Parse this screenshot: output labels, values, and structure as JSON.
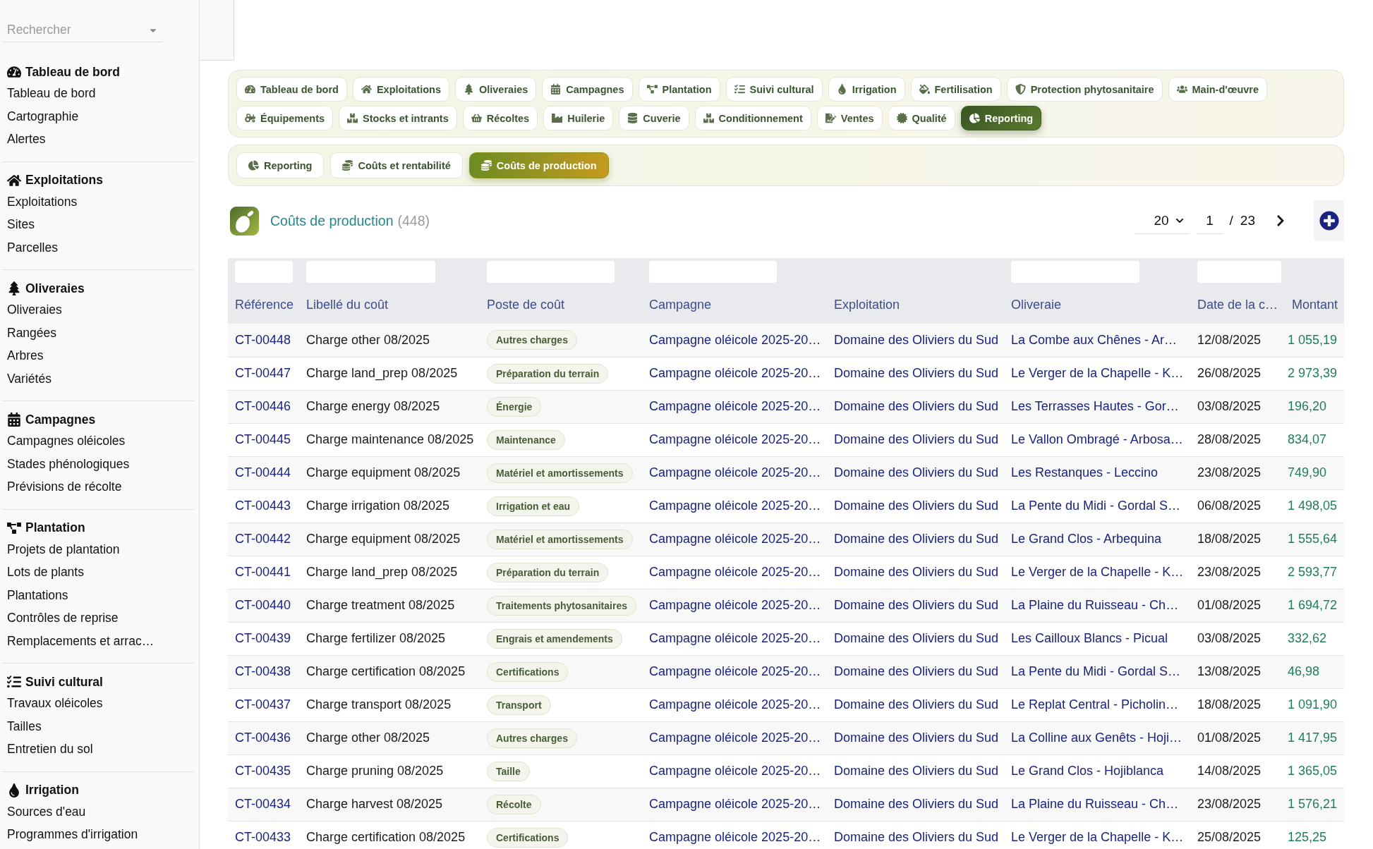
{
  "sidebar": {
    "search": {
      "placeholder": "Rechercher"
    },
    "groups": [
      {
        "title": "Tableau de bord",
        "items": [
          "Tableau de bord",
          "Cartographie",
          "Alertes"
        ]
      },
      {
        "title": "Exploitations",
        "items": [
          "Exploitations",
          "Sites",
          "Parcelles"
        ]
      },
      {
        "title": "Oliveraies",
        "items": [
          "Oliveraies",
          "Rangées",
          "Arbres",
          "Variétés"
        ]
      },
      {
        "title": "Campagnes",
        "items": [
          "Campagnes oléicoles",
          "Stades phénologiques",
          "Prévisions de récolte"
        ]
      },
      {
        "title": "Plantation",
        "items": [
          "Projets de plantation",
          "Lots de plants",
          "Plantations",
          "Contrôles de reprise",
          "Remplacements et arrac…"
        ]
      },
      {
        "title": "Suivi cultural",
        "items": [
          "Travaux oléicoles",
          "Tailles",
          "Entretien du sol"
        ]
      },
      {
        "title": "Irrigation",
        "items": [
          "Sources d'eau",
          "Programmes d'irrigation"
        ]
      }
    ]
  },
  "module_nav": [
    [
      {
        "label": "Tableau de bord",
        "selected": false
      },
      {
        "label": "Exploitations",
        "selected": false
      },
      {
        "label": "Oliveraies",
        "selected": false
      },
      {
        "label": "Campagnes",
        "selected": false
      },
      {
        "label": "Plantation",
        "selected": false
      },
      {
        "label": "Suivi cultural",
        "selected": false
      },
      {
        "label": "Irrigation",
        "selected": false
      },
      {
        "label": "Fertilisation",
        "selected": false
      },
      {
        "label": "Protection phytosanitaire",
        "selected": false
      },
      {
        "label": "Main-d'œuvre",
        "selected": false
      }
    ],
    [
      {
        "label": "Équipements",
        "selected": false
      },
      {
        "label": "Stocks et intrants",
        "selected": false
      },
      {
        "label": "Récoltes",
        "selected": false
      },
      {
        "label": "Huilerie",
        "selected": false
      },
      {
        "label": "Cuverie",
        "selected": false
      },
      {
        "label": "Conditionnement",
        "selected": false
      },
      {
        "label": "Ventes",
        "selected": false
      },
      {
        "label": "Qualité",
        "selected": false
      },
      {
        "label": "Reporting",
        "selected": true
      }
    ]
  ],
  "sub_nav": [
    {
      "label": "Reporting",
      "selected": false
    },
    {
      "label": "Coûts et rentabilité",
      "selected": false
    },
    {
      "label": "Coûts de production",
      "selected": true
    }
  ],
  "list_header": {
    "title": "Coûts de production",
    "count": "(448)",
    "page_size": "20",
    "page": "1",
    "separator": "/",
    "page_count": "23"
  },
  "table": {
    "columns": [
      {
        "label": "Référence",
        "filter": true
      },
      {
        "label": "Libellé du coût",
        "filter": true
      },
      {
        "label": "Poste de coût",
        "filter": true
      },
      {
        "label": "Campagne",
        "filter": true
      },
      {
        "label": "Exploitation",
        "filter": false
      },
      {
        "label": "Oliveraie",
        "filter": true
      },
      {
        "label": "Date de la c…",
        "filter": true
      },
      {
        "label": "Montant",
        "filter": false
      }
    ],
    "rows": [
      {
        "reference": "CT-00448",
        "label": "Charge other 08/2025",
        "cost_type": "Autres charges",
        "campaign": "Campagne oléicole 2025-20…",
        "farm": "Domaine des Oliviers du Sud",
        "grove": "La Combe aux Chênes - Ar…",
        "date": "12/08/2025",
        "amount": "1 055,19"
      },
      {
        "reference": "CT-00447",
        "label": "Charge land_prep 08/2025",
        "cost_type": "Préparation du terrain",
        "campaign": "Campagne oléicole 2025-20…",
        "farm": "Domaine des Oliviers du Sud",
        "grove": "Le Verger de la Chapelle - K…",
        "date": "26/08/2025",
        "amount": "2 973,39"
      },
      {
        "reference": "CT-00446",
        "label": "Charge energy 08/2025",
        "cost_type": "Énergie",
        "campaign": "Campagne oléicole 2025-20…",
        "farm": "Domaine des Oliviers du Sud",
        "grove": "Les Terrasses Hautes - Gor…",
        "date": "03/08/2025",
        "amount": "196,20"
      },
      {
        "reference": "CT-00445",
        "label": "Charge maintenance 08/2025",
        "cost_type": "Maintenance",
        "campaign": "Campagne oléicole 2025-20…",
        "farm": "Domaine des Oliviers du Sud",
        "grove": "Le Vallon Ombragé - Arbosa…",
        "date": "28/08/2025",
        "amount": "834,07"
      },
      {
        "reference": "CT-00444",
        "label": "Charge equipment 08/2025",
        "cost_type": "Matériel et amortissements",
        "campaign": "Campagne oléicole 2025-20…",
        "farm": "Domaine des Oliviers du Sud",
        "grove": "Les Restanques - Leccino",
        "date": "23/08/2025",
        "amount": "749,90"
      },
      {
        "reference": "CT-00443",
        "label": "Charge irrigation 08/2025",
        "cost_type": "Irrigation et eau",
        "campaign": "Campagne oléicole 2025-20…",
        "farm": "Domaine des Oliviers du Sud",
        "grove": "La Pente du Midi - Gordal S…",
        "date": "06/08/2025",
        "amount": "1 498,05"
      },
      {
        "reference": "CT-00442",
        "label": "Charge equipment 08/2025",
        "cost_type": "Matériel et amortissements",
        "campaign": "Campagne oléicole 2025-20…",
        "farm": "Domaine des Oliviers du Sud",
        "grove": "Le Grand Clos - Arbequina",
        "date": "18/08/2025",
        "amount": "1 555,64"
      },
      {
        "reference": "CT-00441",
        "label": "Charge land_prep 08/2025",
        "cost_type": "Préparation du terrain",
        "campaign": "Campagne oléicole 2025-20…",
        "farm": "Domaine des Oliviers du Sud",
        "grove": "Le Verger de la Chapelle - K…",
        "date": "23/08/2025",
        "amount": "2 593,77"
      },
      {
        "reference": "CT-00440",
        "label": "Charge treatment 08/2025",
        "cost_type": "Traitements phytosanitaires",
        "campaign": "Campagne oléicole 2025-20…",
        "farm": "Domaine des Oliviers du Sud",
        "grove": "La Plaine du Ruisseau - Ch…",
        "date": "01/08/2025",
        "amount": "1 694,72"
      },
      {
        "reference": "CT-00439",
        "label": "Charge fertilizer 08/2025",
        "cost_type": "Engrais et amendements",
        "campaign": "Campagne oléicole 2025-20…",
        "farm": "Domaine des Oliviers du Sud",
        "grove": "Les Cailloux Blancs - Picual",
        "date": "03/08/2025",
        "amount": "332,62"
      },
      {
        "reference": "CT-00438",
        "label": "Charge certification 08/2025",
        "cost_type": "Certifications",
        "campaign": "Campagne oléicole 2025-20…",
        "farm": "Domaine des Oliviers du Sud",
        "grove": "La Pente du Midi - Gordal S…",
        "date": "13/08/2025",
        "amount": "46,98"
      },
      {
        "reference": "CT-00437",
        "label": "Charge transport 08/2025",
        "cost_type": "Transport",
        "campaign": "Campagne oléicole 2025-20…",
        "farm": "Domaine des Oliviers du Sud",
        "grove": "Le Replat Central - Picholin…",
        "date": "18/08/2025",
        "amount": "1 091,90"
      },
      {
        "reference": "CT-00436",
        "label": "Charge other 08/2025",
        "cost_type": "Autres charges",
        "campaign": "Campagne oléicole 2025-20…",
        "farm": "Domaine des Oliviers du Sud",
        "grove": "La Colline aux Genêts - Hoji…",
        "date": "01/08/2025",
        "amount": "1 417,95"
      },
      {
        "reference": "CT-00435",
        "label": "Charge pruning 08/2025",
        "cost_type": "Taille",
        "campaign": "Campagne oléicole 2025-20…",
        "farm": "Domaine des Oliviers du Sud",
        "grove": "Le Grand Clos - Hojiblanca",
        "date": "14/08/2025",
        "amount": "1 365,05"
      },
      {
        "reference": "CT-00434",
        "label": "Charge harvest 08/2025",
        "cost_type": "Récolte",
        "campaign": "Campagne oléicole 2025-20…",
        "farm": "Domaine des Oliviers du Sud",
        "grove": "La Plaine du Ruisseau - Ch…",
        "date": "23/08/2025",
        "amount": "1 576,21"
      },
      {
        "reference": "CT-00433",
        "label": "Charge certification 08/2025",
        "cost_type": "Certifications",
        "campaign": "Campagne oléicole 2025-20…",
        "farm": "Domaine des Oliviers du Sud",
        "grove": "Le Verger de la Chapelle - K…",
        "date": "25/08/2025",
        "amount": "125,25"
      }
    ]
  }
}
